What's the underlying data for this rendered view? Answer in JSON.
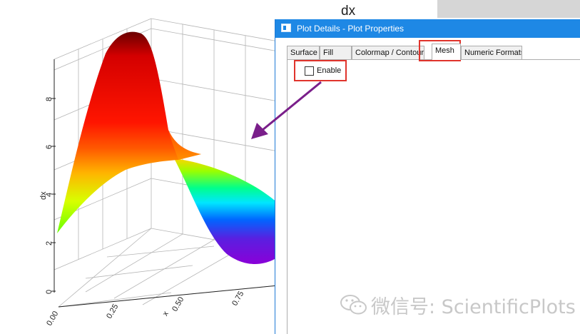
{
  "plot": {
    "title": "dx",
    "z_axis_label": "dx",
    "z_ticks": [
      "0",
      "2",
      "4",
      "6",
      "8"
    ],
    "x_axis_label": "x",
    "x_ticks": [
      "0.00",
      "0.25",
      "0.50",
      "0.75"
    ]
  },
  "dialog": {
    "title": "Plot Details - Plot Properties",
    "tabs": [
      {
        "label": "Surface"
      },
      {
        "label": "Fill"
      },
      {
        "label": "Colormap / Contours"
      },
      {
        "label": "Mesh",
        "active": true
      },
      {
        "label": "Numeric Formats"
      }
    ],
    "mesh_panel": {
      "enable_label": "Enable",
      "enable_checked": false
    }
  },
  "annotations": {
    "highlight_color": "#e0342c",
    "arrow_color": "#7a1f8a"
  },
  "watermark": {
    "text": "微信号: ScientificPlots"
  }
}
